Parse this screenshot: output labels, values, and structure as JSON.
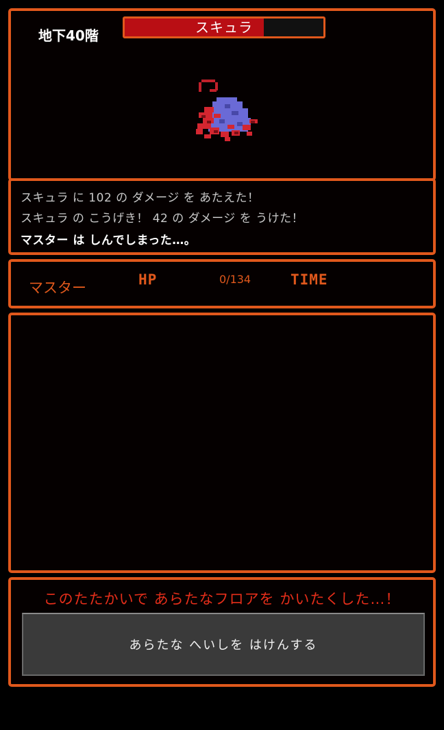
{
  "battle": {
    "floor_label": "地下40階",
    "enemy_name": "スキュラ",
    "enemy_hp_fraction": 0.7,
    "enemy_sprite": "scylla-monster"
  },
  "log": {
    "lines": [
      "スキュラ に 102 の ダメージ を あたえた！",
      "スキュラ の こうげき！ 42 の ダメージ を うけた！",
      "マスター は しんでしまった…。"
    ]
  },
  "status": {
    "name": "マスター",
    "hp_label": "HP",
    "hp_value": "0/134",
    "time_label": "TIME"
  },
  "result": {
    "message": "このたたかいで あらたなフロアを かいたくした…！",
    "button_label": "あらたな へいしを はけんする"
  },
  "colors": {
    "accent": "#e0581c",
    "hp_bar": "#b90e14",
    "message": "#e52e1a",
    "button": "#3a3a3a"
  }
}
